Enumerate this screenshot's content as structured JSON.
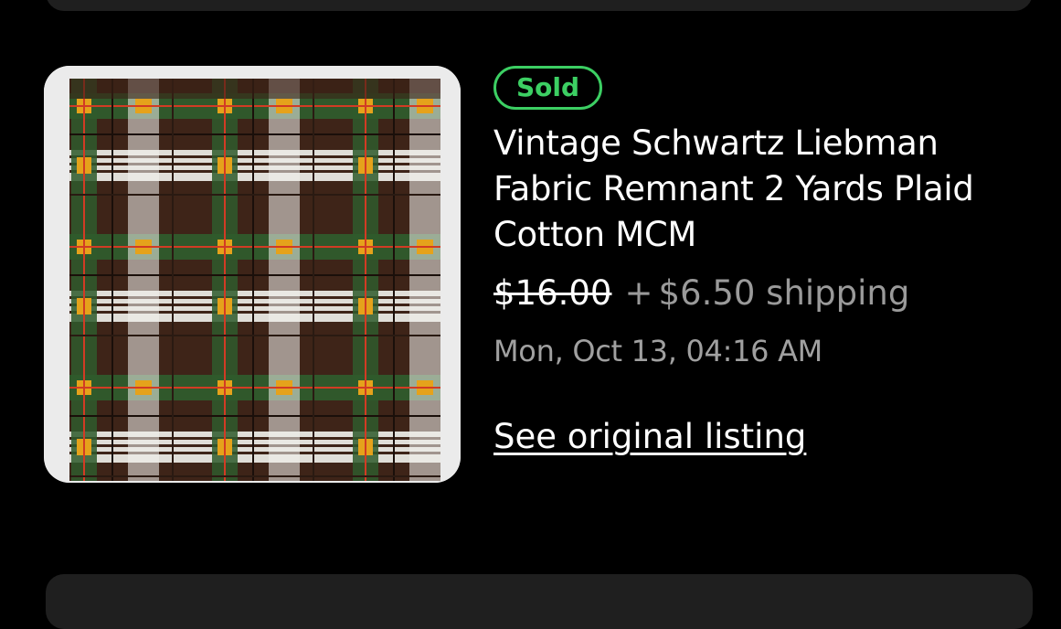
{
  "listing": {
    "status_badge": "Sold",
    "title": "Vintage Schwartz Liebman Fabric Remnant 2 Yards Plaid Cotton MCM",
    "price": "$16.00",
    "plus_sign": "+",
    "shipping": "$6.50 shipping",
    "date": "Mon, Oct 13, 04:16 AM",
    "see_listing_link": "See original listing",
    "image_subject": "plaid-fabric-photo"
  },
  "colors": {
    "background": "#000000",
    "card": "#1f1f1f",
    "sold_green": "#3ccf63",
    "secondary_text": "#9a9a9a"
  }
}
